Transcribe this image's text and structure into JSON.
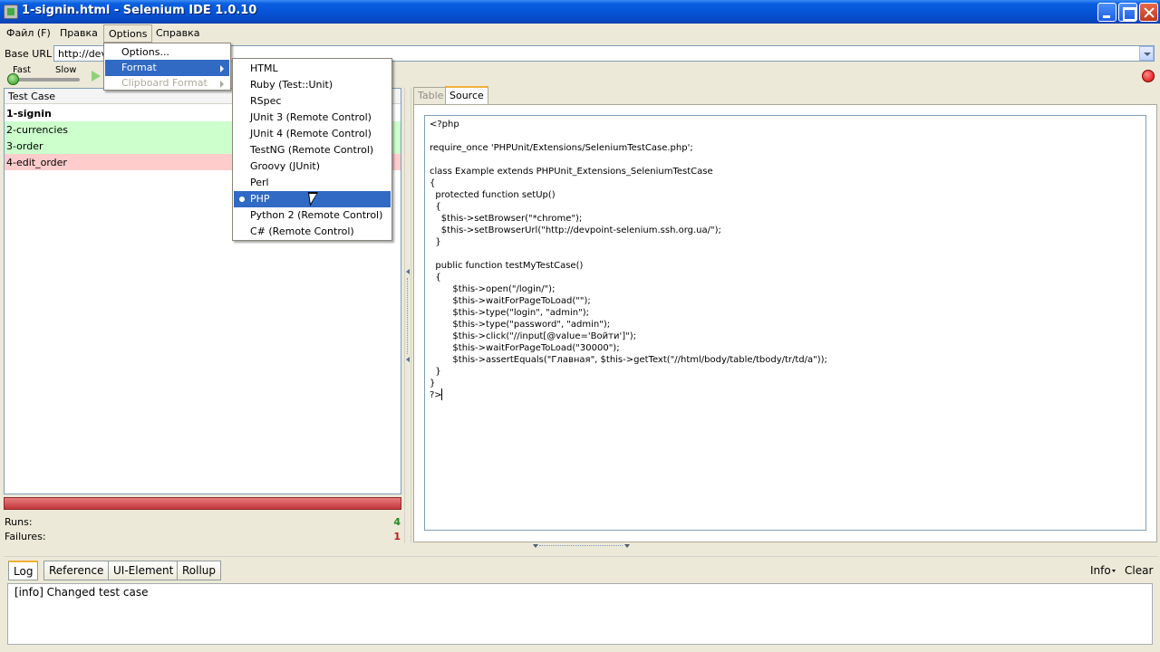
{
  "window": {
    "title": "1-signin.html - Selenium IDE 1.0.10"
  },
  "menubar": {
    "file": "Файл (F)",
    "edit": "Правка",
    "options": "Options",
    "help": "Справка"
  },
  "options_menu": {
    "items": [
      "Options...",
      "Format",
      "Clipboard Format"
    ]
  },
  "format_menu": {
    "items": [
      "HTML",
      "Ruby (Test::Unit)",
      "RSpec",
      "JUnit 3 (Remote Control)",
      "JUnit 4 (Remote Control)",
      "TestNG (Remote Control)",
      "Groovy (JUnit)",
      "Perl",
      "PHP",
      "Python 2 (Remote Control)",
      "C# (Remote Control)"
    ],
    "selected": "PHP"
  },
  "base_url": {
    "label": "Base URL",
    "value": "http://dev"
  },
  "speed": {
    "fast": "Fast",
    "slow": "Slow"
  },
  "test_cases": {
    "header": "Test Case",
    "rows": [
      {
        "name": "1-signin",
        "state": "current"
      },
      {
        "name": "2-currencies",
        "state": "passed"
      },
      {
        "name": "3-order",
        "state": "passed"
      },
      {
        "name": "4-edit_order",
        "state": "failed"
      }
    ]
  },
  "stats": {
    "runs_label": "Runs:",
    "runs": "4",
    "failures_label": "Failures:",
    "failures": "1"
  },
  "editor_tabs": {
    "table": "Table",
    "source": "Source"
  },
  "source_code": [
    "<?php",
    "",
    "require_once 'PHPUnit/Extensions/SeleniumTestCase.php';",
    "",
    "class Example extends PHPUnit_Extensions_SeleniumTestCase",
    "{",
    "  protected function setUp()",
    "  {",
    "    $this->setBrowser(\"*chrome\");",
    "    $this->setBrowserUrl(\"http://devpoint-selenium.ssh.org.ua/\");",
    "  }",
    "",
    "  public function testMyTestCase()",
    "  {",
    "        $this->open(\"/login/\");",
    "        $this->waitForPageToLoad(\"\");",
    "        $this->type(\"login\", \"admin\");",
    "        $this->type(\"password\", \"admin\");",
    "        $this->click(\"//input[@value='Войти']\");",
    "        $this->waitForPageToLoad(\"30000\");",
    "        $this->assertEquals(\"Главная\", $this->getText(\"//html/body/table/tbody/tr/td/a\"));",
    "  }",
    "}",
    "?>"
  ],
  "bottom_tabs": [
    "Log",
    "Reference",
    "UI-Element",
    "Rollup"
  ],
  "log": {
    "info_label": "Info",
    "clear_label": "Clear",
    "message": "[info] Changed test case"
  }
}
